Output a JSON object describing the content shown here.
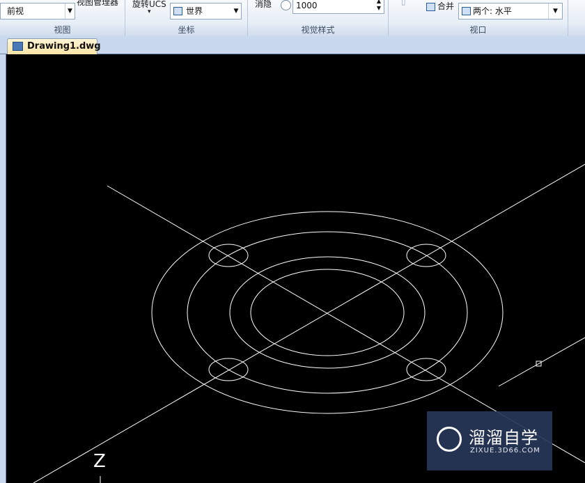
{
  "ribbon": {
    "view": {
      "dropdown_value": "前视",
      "manager_label": "视图管理器",
      "title": "视图"
    },
    "ucs": {
      "rotate_label": "旋转UCS",
      "dropdown_value": "世界",
      "title": "坐标"
    },
    "visual_style": {
      "hide_label": "消隐",
      "value": "1000",
      "title": "视觉样式"
    },
    "viewport": {
      "merge_label": "合并",
      "dropdown_value": "两个: 水平",
      "title": "视口"
    }
  },
  "tabs": [
    {
      "label": "Drawing1.dwg"
    }
  ],
  "canvas": {
    "axis_label": "Z"
  },
  "watermark": {
    "text": "溜溜自学",
    "sub": "ZIXUE.3D66.COM"
  }
}
